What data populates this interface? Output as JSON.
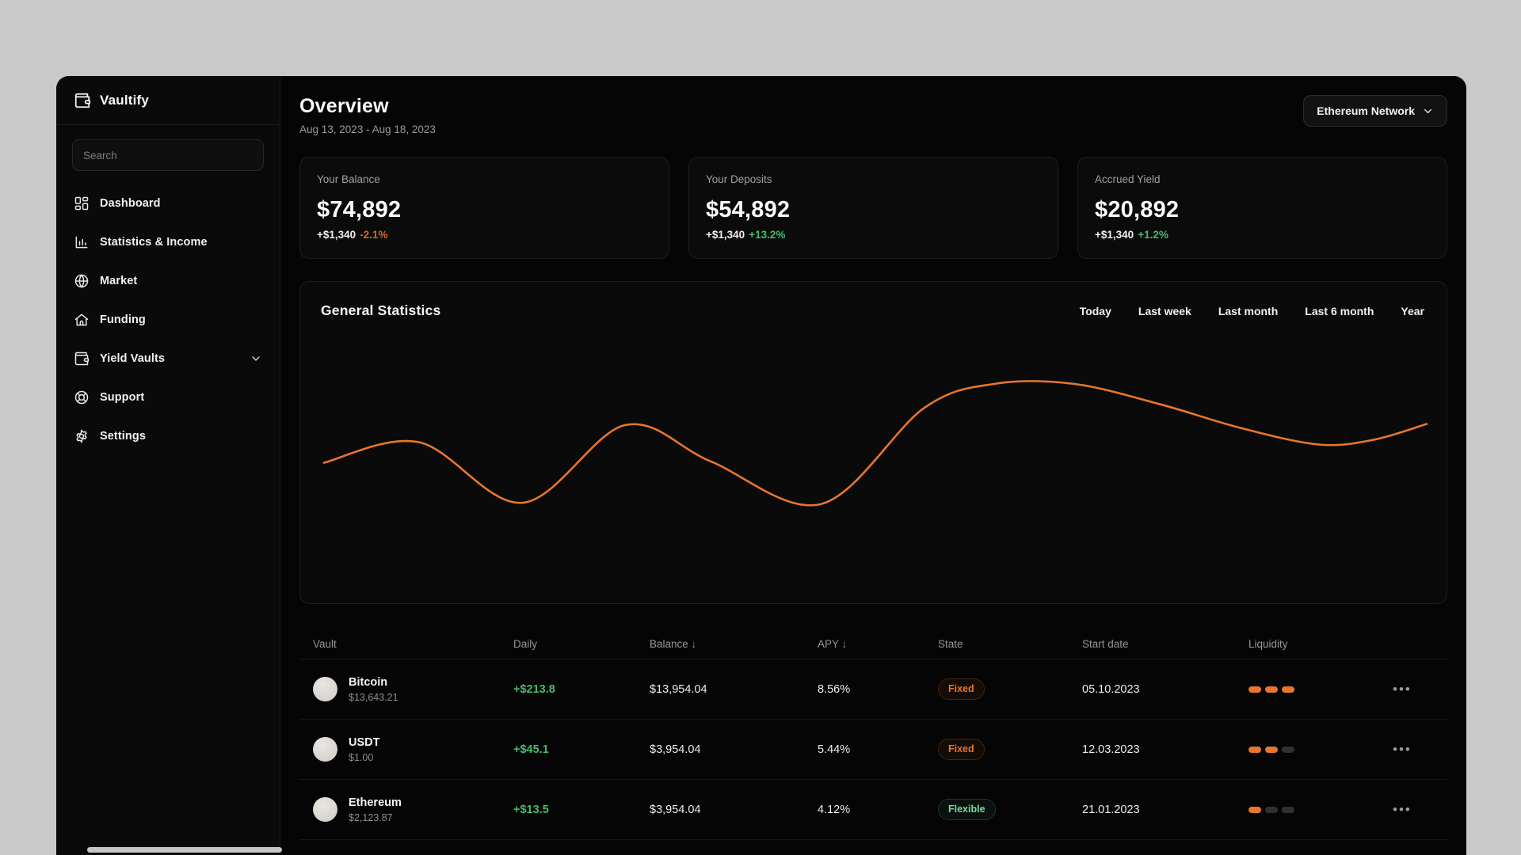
{
  "app": {
    "name": "Vaultify"
  },
  "sidebar": {
    "search_placeholder": "Search",
    "items": [
      {
        "label": "Dashboard",
        "icon": "dashboard-icon"
      },
      {
        "label": "Statistics & Income",
        "icon": "bar-chart-icon"
      },
      {
        "label": "Market",
        "icon": "globe-icon"
      },
      {
        "label": "Funding",
        "icon": "bank-icon"
      },
      {
        "label": "Yield Vaults",
        "icon": "wallet-icon",
        "has_chevron": true
      },
      {
        "label": "Support",
        "icon": "lifebuoy-icon"
      },
      {
        "label": "Settings",
        "icon": "gear-icon"
      }
    ]
  },
  "header": {
    "title": "Overview",
    "date_range": "Aug 13, 2023 - Aug 18, 2023",
    "network_selector": "Ethereum Network"
  },
  "stat_cards": [
    {
      "label": "Your Balance",
      "value": "$74,892",
      "delta_amount": "+$1,340",
      "delta_pct": "-2.1%",
      "delta_direction": "down"
    },
    {
      "label": "Your Deposits",
      "value": "$54,892",
      "delta_amount": "+$1,340",
      "delta_pct": "+13.2%",
      "delta_direction": "up"
    },
    {
      "label": "Accrued Yield",
      "value": "$20,892",
      "delta_amount": "+$1,340",
      "delta_pct": "+1.2%",
      "delta_direction": "up"
    }
  ],
  "chart": {
    "title": "General Statistics",
    "filters": [
      "Today",
      "Last week",
      "Last month",
      "Last 6 month",
      "Year"
    ]
  },
  "chart_data": {
    "type": "line",
    "title": "General Statistics",
    "xlabel": "",
    "ylabel": "",
    "axes_visible": false,
    "grid": false,
    "legend": false,
    "line_color": "#e8762c",
    "x_pct": [
      0,
      8.6,
      18,
      27.3,
      35.1,
      45.1,
      54.4,
      60.8,
      68,
      75.9,
      83,
      90.2,
      95.2,
      100
    ],
    "values": [
      34,
      51,
      1,
      65,
      35,
      0,
      79,
      99,
      99,
      82,
      63,
      49,
      53,
      66
    ],
    "value_range": [
      0,
      100
    ]
  },
  "table": {
    "columns": [
      {
        "label": "Vault",
        "sorted": false
      },
      {
        "label": "Daily",
        "sorted": false
      },
      {
        "label": "Balance",
        "sorted": true
      },
      {
        "label": "APY",
        "sorted": true
      },
      {
        "label": "State",
        "sorted": false
      },
      {
        "label": "Start date",
        "sorted": false
      },
      {
        "label": "Liquidity",
        "sorted": false
      },
      {
        "label": "",
        "sorted": false
      }
    ],
    "sort_arrow": "↓",
    "row_menu_label": "•••",
    "rows": [
      {
        "name": "Bitcoin",
        "price": "$13,643.21",
        "daily": "+$213.8",
        "balance": "$13,954.04",
        "apy": "8.56%",
        "state": "Fixed",
        "start_date": "05.10.2023",
        "liquidity_active": 3,
        "liquidity_total": 3
      },
      {
        "name": "USDT",
        "price": "$1.00",
        "daily": "+$45.1",
        "balance": "$3,954.04",
        "apy": "5.44%",
        "state": "Fixed",
        "start_date": "12.03.2023",
        "liquidity_active": 2,
        "liquidity_total": 3
      },
      {
        "name": "Ethereum",
        "price": "$2,123.87",
        "daily": "+$13.5",
        "balance": "$3,954.04",
        "apy": "4.12%",
        "state": "Flexible",
        "start_date": "21.01.2023",
        "liquidity_active": 1,
        "liquidity_total": 3
      }
    ]
  },
  "colors": {
    "accent_orange": "#e8762c",
    "positive_green": "#43bd6e",
    "negative_orange": "#d9671f",
    "page_background": "#c9c9c9",
    "surface": "#0a0a0a"
  }
}
